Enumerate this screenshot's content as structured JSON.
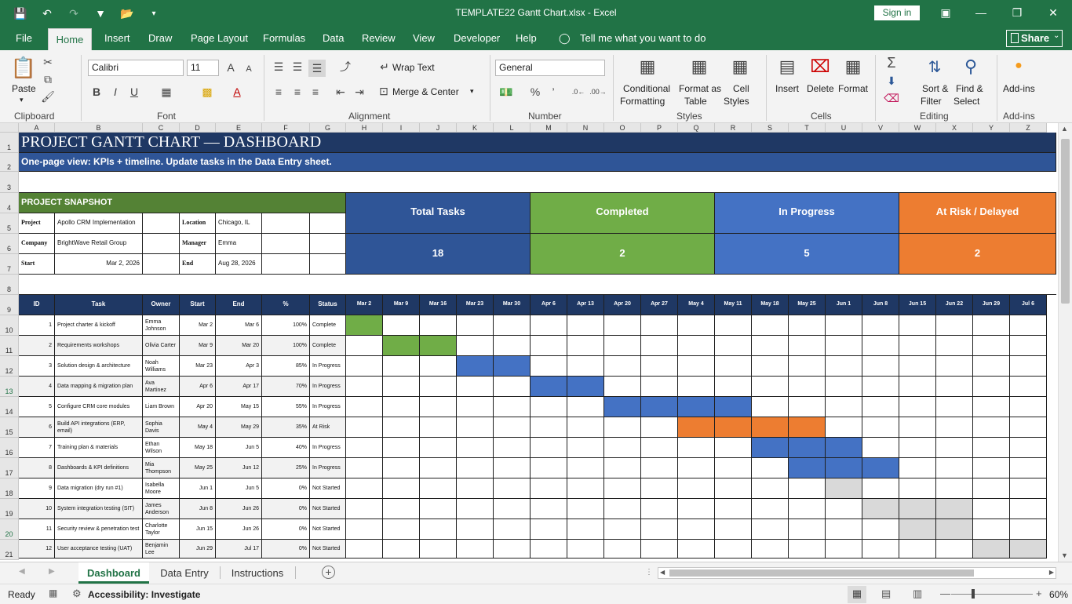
{
  "app": {
    "title": "TEMPLATE22 Gantt Chart.xlsx  -  Excel",
    "sign_in": "Sign in",
    "share": "Share",
    "accent": "#217346"
  },
  "menu": [
    "File",
    "Home",
    "Insert",
    "Draw",
    "Page Layout",
    "Formulas",
    "Data",
    "Review",
    "View",
    "Developer",
    "Help"
  ],
  "tell_me": "Tell me what you want to do",
  "ribbon": {
    "clipboard": {
      "label": "Clipboard",
      "paste": "Paste"
    },
    "font": {
      "label": "Font",
      "name": "Calibri",
      "size": "11",
      "bold": "B",
      "italic": "I",
      "underline": "U"
    },
    "alignment": {
      "label": "Alignment",
      "wrap": "Wrap Text",
      "merge": "Merge & Center"
    },
    "number": {
      "label": "Number",
      "format": "General",
      "percent": "%",
      "comma": "’"
    },
    "styles": {
      "label": "Styles",
      "conditional1": "Conditional",
      "conditional2": "Formatting",
      "table1": "Format as",
      "table2": "Table",
      "cell1": "Cell",
      "cell2": "Styles"
    },
    "cells": {
      "label": "Cells",
      "insert": "Insert",
      "delete": "Delete",
      "format": "Format"
    },
    "editing": {
      "label": "Editing",
      "sort1": "Sort &",
      "sort2": "Filter",
      "find1": "Find &",
      "find2": "Select"
    },
    "addins": {
      "label": "Add-ins",
      "button": "Add-ins"
    }
  },
  "columns": [
    "A",
    "B",
    "C",
    "D",
    "E",
    "F",
    "G",
    "H",
    "I",
    "J",
    "K",
    "L",
    "M",
    "N",
    "O",
    "P",
    "Q",
    "R",
    "S",
    "T",
    "U",
    "V",
    "W",
    "X",
    "Y",
    "Z"
  ],
  "rows": [
    "1",
    "2",
    "3",
    "4",
    "5",
    "6",
    "7",
    "8",
    "9",
    "10",
    "11",
    "12",
    "13",
    "14",
    "15",
    "16",
    "17",
    "18",
    "19",
    "20",
    "21"
  ],
  "sheet": {
    "title": "PROJECT GANTT CHART — DASHBOARD",
    "subtitle": "One-page view: KPIs + timeline. Update tasks in the Data Entry sheet.",
    "snapshot": {
      "header": "PROJECT SNAPSHOT",
      "project_label": "Project",
      "project": "Apollo CRM Implementation",
      "location_label": "Location",
      "location": "Chicago, IL",
      "company_label": "Company",
      "company": "BrightWave Retail Group",
      "manager_label": "Manager",
      "manager": "Emma Johnson",
      "start_label": "Start",
      "start": "Mar 2, 2026",
      "end_label": "End",
      "end": "Aug 28, 2026"
    },
    "kpis": [
      {
        "label": "Total Tasks",
        "value": "18",
        "color": "#2f5597"
      },
      {
        "label": "Completed",
        "value": "2",
        "color": "#70ad47"
      },
      {
        "label": "In Progress",
        "value": "5",
        "color": "#4472c4"
      },
      {
        "label": "At Risk / Delayed",
        "value": "2",
        "color": "#ed7d31"
      }
    ],
    "table_headers": [
      "ID",
      "Task",
      "Owner",
      "Start",
      "End",
      "%",
      "Status"
    ],
    "weeks": [
      "Mar 2",
      "Mar 9",
      "Mar 16",
      "Mar 23",
      "Mar 30",
      "Apr 6",
      "Apr 13",
      "Apr 20",
      "Apr 27",
      "May 4",
      "May 11",
      "May 18",
      "May 25",
      "Jun 1",
      "Jun 8",
      "Jun 15",
      "Jun 22",
      "Jun 29",
      "Jul 6"
    ],
    "status_colors": {
      "Complete": "#70ad47",
      "In Progress": "#4472c4",
      "At Risk": "#ed7d31",
      "Not Started": "#d9d9d9"
    },
    "tasks": [
      {
        "id": "1",
        "task": "Project charter & kickoff",
        "owner": "Emma Johnson",
        "start": "Mar 2",
        "end": "Mar 6",
        "pct": "100%",
        "status": "Complete",
        "s": 0,
        "e": 0
      },
      {
        "id": "2",
        "task": "Requirements workshops",
        "owner": "Olivia Carter",
        "start": "Mar 9",
        "end": "Mar 20",
        "pct": "100%",
        "status": "Complete",
        "s": 1,
        "e": 2
      },
      {
        "id": "3",
        "task": "Solution design & architecture",
        "owner": "Noah Williams",
        "start": "Mar 23",
        "end": "Apr 3",
        "pct": "85%",
        "status": "In Progress",
        "s": 3,
        "e": 4
      },
      {
        "id": "4",
        "task": "Data mapping & migration plan",
        "owner": "Ava Martinez",
        "start": "Apr 6",
        "end": "Apr 17",
        "pct": "70%",
        "status": "In Progress",
        "s": 5,
        "e": 6
      },
      {
        "id": "5",
        "task": "Configure CRM core modules",
        "owner": "Liam Brown",
        "start": "Apr 20",
        "end": "May 15",
        "pct": "55%",
        "status": "In Progress",
        "s": 7,
        "e": 10
      },
      {
        "id": "6",
        "task": "Build API integrations (ERP, email)",
        "owner": "Sophia Davis",
        "start": "May 4",
        "end": "May 29",
        "pct": "35%",
        "status": "At Risk",
        "s": 9,
        "e": 12
      },
      {
        "id": "7",
        "task": "Training plan & materials",
        "owner": "Ethan Wilson",
        "start": "May 18",
        "end": "Jun 5",
        "pct": "40%",
        "status": "In Progress",
        "s": 11,
        "e": 13
      },
      {
        "id": "8",
        "task": "Dashboards & KPI definitions",
        "owner": "Mia Thompson",
        "start": "May 25",
        "end": "Jun 12",
        "pct": "25%",
        "status": "In Progress",
        "s": 12,
        "e": 14
      },
      {
        "id": "9",
        "task": "Data migration (dry run #1)",
        "owner": "Isabella Moore",
        "start": "Jun 1",
        "end": "Jun 5",
        "pct": "0%",
        "status": "Not Started",
        "s": 13,
        "e": 13
      },
      {
        "id": "10",
        "task": "System integration testing (SIT)",
        "owner": "James Anderson",
        "start": "Jun 8",
        "end": "Jun 26",
        "pct": "0%",
        "status": "Not Started",
        "s": 14,
        "e": 16
      },
      {
        "id": "11",
        "task": "Security review & penetration test",
        "owner": "Charlotte Taylor",
        "start": "Jun 15",
        "end": "Jun 26",
        "pct": "0%",
        "status": "Not Started",
        "s": 15,
        "e": 16
      },
      {
        "id": "12",
        "task": "User acceptance testing (UAT)",
        "owner": "Benjamin Lee",
        "start": "Jun 29",
        "end": "Jul 17",
        "pct": "0%",
        "status": "Not Started",
        "s": 17,
        "e": 19
      }
    ]
  },
  "sheet_tabs": [
    "Dashboard",
    "Data Entry",
    "Instructions"
  ],
  "status": {
    "ready": "Ready",
    "accessibility": "Accessibility: Investigate",
    "zoom": "60%"
  }
}
